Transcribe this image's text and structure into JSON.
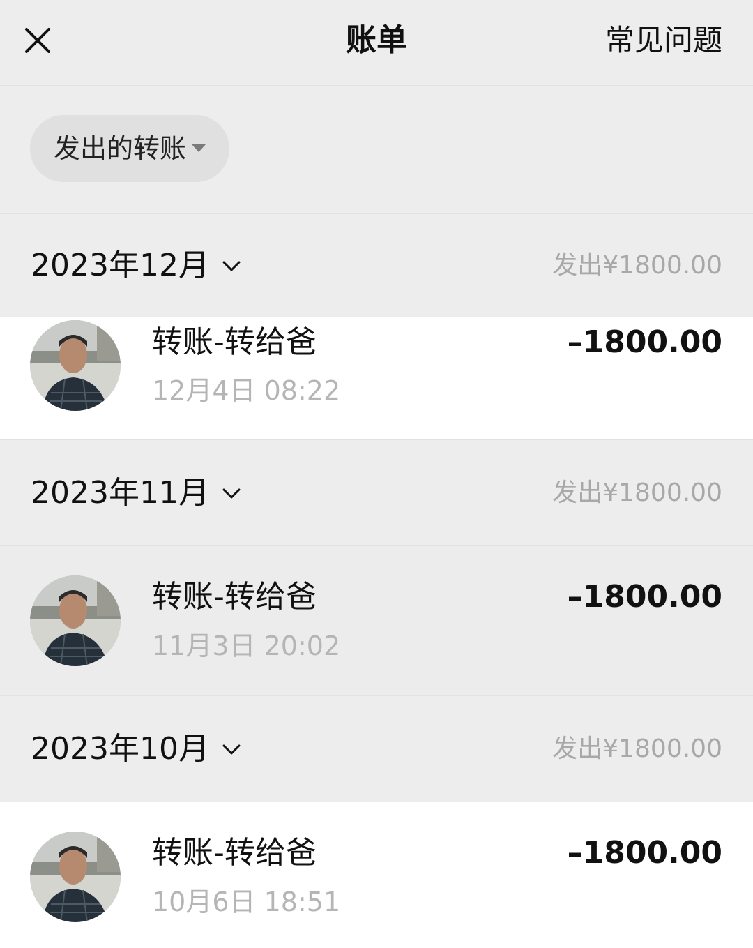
{
  "header": {
    "title": "账单",
    "faq_label": "常见问题",
    "close_icon": "close-icon"
  },
  "filter": {
    "label": "发出的转账",
    "icon": "caret-down-icon"
  },
  "months": [
    {
      "label": "2023年12月",
      "total": "发出¥1800.00",
      "transaction": {
        "name": "转账-转给爸",
        "time": "12月4日 08:22",
        "amount": "–1800.00"
      }
    },
    {
      "label": "2023年11月",
      "total": "发出¥1800.00",
      "transaction": {
        "name": "转账-转给爸",
        "time": "11月3日 20:02",
        "amount": "–1800.00"
      }
    },
    {
      "label": "2023年10月",
      "total": "发出¥1800.00",
      "transaction": {
        "name": "转账-转给爸",
        "time": "10月6日 18:51",
        "amount": "–1800.00"
      }
    }
  ],
  "colors": {
    "background": "#ededed",
    "row": "#ffffff",
    "row_pressed": "#ececec",
    "muted_text": "#b5b5b5",
    "total_text": "#a8a8a8"
  }
}
